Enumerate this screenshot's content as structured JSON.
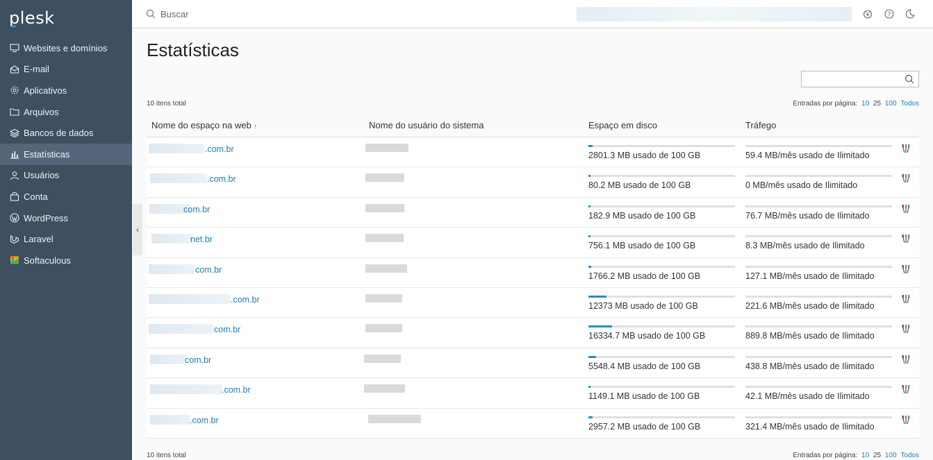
{
  "app": {
    "logo": "plesk"
  },
  "sidebar": {
    "items": [
      {
        "label": "Websites e domínios",
        "icon": "monitor-icon"
      },
      {
        "label": "E-mail",
        "icon": "mail-icon"
      },
      {
        "label": "Aplicativos",
        "icon": "gear-icon"
      },
      {
        "label": "Arquivos",
        "icon": "folder-icon"
      },
      {
        "label": "Bancos de dados",
        "icon": "database-icon"
      },
      {
        "label": "Estatísticas",
        "icon": "bar-chart-icon",
        "active": true
      },
      {
        "label": "Usuários",
        "icon": "user-icon"
      },
      {
        "label": "Conta",
        "icon": "account-icon"
      },
      {
        "label": "WordPress",
        "icon": "wordpress-icon"
      },
      {
        "label": "Laravel",
        "icon": "laravel-icon"
      },
      {
        "label": "Softaculous",
        "icon": "softaculous-icon"
      }
    ]
  },
  "header": {
    "search_placeholder": "Buscar"
  },
  "page": {
    "title": "Estatísticas"
  },
  "list": {
    "total": "10 itens total",
    "per_page_label": "Entradas por página:",
    "per_page_options": [
      "10",
      "25",
      "100",
      "Todos"
    ],
    "columns": {
      "name": "Nome do espaço na web",
      "sort_indicator": "↑",
      "user": "Nome do usuário do sistema",
      "disk": "Espaço em disco",
      "traffic": "Tráfego"
    },
    "rows": [
      {
        "domain_suffix": ".com.br",
        "disk": "2801.3 MB usado de 100 GB",
        "disk_ratio": 0.027,
        "traffic": "59.4 MB/mês usado de Ilimitado"
      },
      {
        "domain_suffix": ".com.br",
        "disk": "80.2 MB usado de 100 GB",
        "disk_ratio": 0.001,
        "traffic": "0 MB/mês usado de Ilimitado"
      },
      {
        "domain_suffix": "com.br",
        "disk": "182.9 MB usado de 100 GB",
        "disk_ratio": 0.002,
        "traffic": "76.7 MB/mês usado de Ilimitado"
      },
      {
        "domain_suffix": "net.br",
        "disk": "756.1 MB usado de 100 GB",
        "disk_ratio": 0.007,
        "traffic": "8.3 MB/mês usado de Ilimitado"
      },
      {
        "domain_suffix": "com.br",
        "disk": "1766.2 MB usado de 100 GB",
        "disk_ratio": 0.017,
        "traffic": "127.1 MB/mês usado de Ilimitado"
      },
      {
        "domain_suffix": ".com.br",
        "disk": "12373 MB usado de 100 GB",
        "disk_ratio": 0.121,
        "traffic": "221.6 MB/mês usado de Ilimitado"
      },
      {
        "domain_suffix": "com.br",
        "disk": "16334.7 MB usado de 100 GB",
        "disk_ratio": 0.16,
        "traffic": "889.8 MB/mês usado de Ilimitado"
      },
      {
        "domain_suffix": "com.br",
        "disk": "5548.4 MB usado de 100 GB",
        "disk_ratio": 0.054,
        "traffic": "438.8 MB/mês usado de Ilimitado"
      },
      {
        "domain_suffix": ".com.br",
        "disk": "1149.1 MB usado de 100 GB",
        "disk_ratio": 0.011,
        "traffic": "42.1 MB/mês usado de Ilimitado"
      },
      {
        "domain_suffix": ".com.br",
        "disk": "2957.2 MB usado de 100 GB",
        "disk_ratio": 0.029,
        "traffic": "321.4 MB/mês usado de Ilimitado"
      }
    ]
  }
}
